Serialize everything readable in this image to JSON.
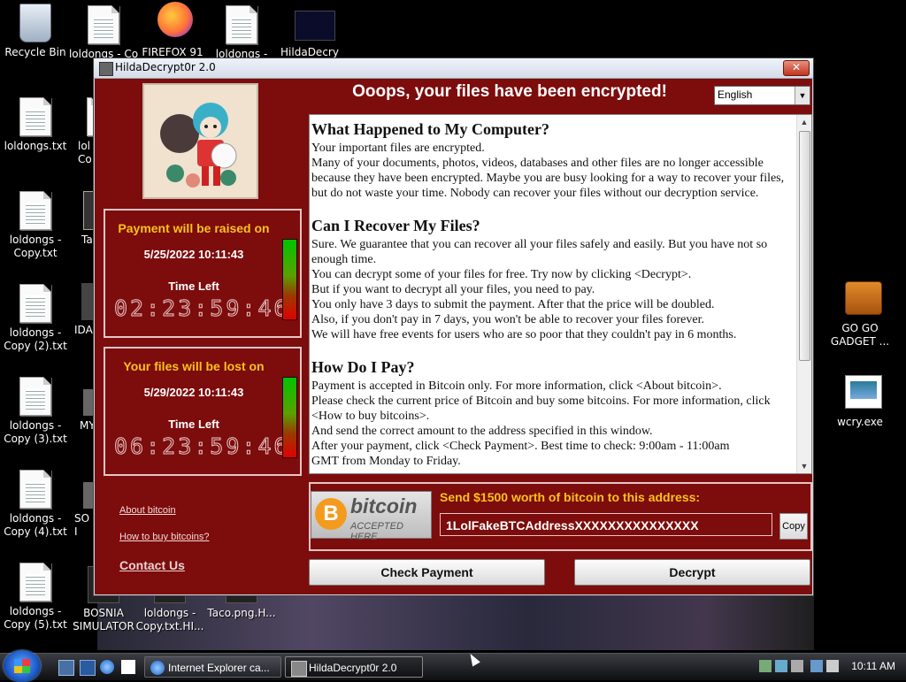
{
  "desktop": {
    "icons_left": [
      {
        "label": "Recycle Bin"
      },
      {
        "label": "loldongs.txt"
      },
      {
        "label": "loldongs - Copy.txt"
      },
      {
        "label": "loldongs - Copy (2).txt"
      },
      {
        "label": "loldongs - Copy (3).txt"
      },
      {
        "label": "loldongs - Copy (4).txt"
      },
      {
        "label": "loldongs - Copy (5).txt"
      }
    ],
    "icons_top": [
      {
        "label": "loldongs - Co"
      },
      {
        "label": "FIREFOX 91"
      },
      {
        "label": "loldongs -"
      },
      {
        "label": "HildaDecry"
      }
    ],
    "icons_partial": [
      {
        "label": "lol Co"
      },
      {
        "label": "Ta"
      },
      {
        "label": "IDA"
      },
      {
        "label": "MY"
      },
      {
        "label": "SO I"
      }
    ],
    "icons_bottom": [
      {
        "label": "BOSNIA SIMULATOR"
      },
      {
        "label": "loldongs - Copy.txt.HI..."
      },
      {
        "label": "Taco.png.H..."
      }
    ],
    "icons_right": [
      {
        "label": "GO GO GADGET ..."
      },
      {
        "label": "wcry.exe"
      }
    ]
  },
  "window": {
    "title": "HildaDecrypt0r 2.0",
    "close": "✕",
    "headline": "Ooops, your files have been encrypted!",
    "language": "English",
    "panel1": {
      "heading": "Payment will be raised on",
      "date": "5/25/2022 10:11:43",
      "label": "Time Left",
      "timer": "02:23:59:46",
      "bar_level": 0.75
    },
    "panel2": {
      "heading": "Your files will be lost on",
      "date": "5/29/2022 10:11:43",
      "label": "Time Left",
      "timer": "06:23:59:46",
      "bar_level": 0.95
    },
    "links": {
      "about": "About bitcoin",
      "howto": "How to buy bitcoins?",
      "contact": "Contact Us"
    },
    "text": {
      "h1": "What Happened to My Computer?",
      "p1": "Your important files are encrypted.",
      "p2": "Many of your documents, photos, videos, databases and other files are no longer accessible because they have been encrypted. Maybe you are busy looking for a way to recover your files, but do not waste your time. Nobody can recover your files without our decryption service.",
      "h2": "Can I Recover My Files?",
      "p3": "Sure. We guarantee that you can recover all your files safely and easily. But you have not so enough time.",
      "p4": "You can decrypt some of your files for free. Try now by clicking <Decrypt>.",
      "p5": "But if you want to decrypt all your files, you need to pay.",
      "p6": "You only have 3 days to submit the payment. After that the price will be doubled.",
      "p7": "Also, if you don't pay in 7 days, you won't be able to recover your files forever.",
      "p8": "We will have free events for users who are so poor that they couldn't pay in 6 months.",
      "h3": "How Do I Pay?",
      "p9": "Payment is accepted in Bitcoin only. For more information, click <About bitcoin>.",
      "p10": "Please check the current price of Bitcoin and buy some bitcoins. For more information, click <How to buy bitcoins>.",
      "p11": "And send the correct amount to the address specified in this window.",
      "p12": "After your payment, click <Check Payment>. Best time to check: 9:00am - 11:00am",
      "p13": "GMT from Monday to Friday."
    },
    "payment": {
      "logo_word": "bitcoin",
      "logo_sub": "ACCEPTED HERE",
      "logo_coin": "B",
      "send_label": "Send $1500 worth of bitcoin to this address:",
      "address": "1LolFakeBTCAddressXXXXXXXXXXXXXXX",
      "copy": "Copy"
    },
    "buttons": {
      "check": "Check Payment",
      "decrypt": "Decrypt"
    }
  },
  "taskbar": {
    "tasks": [
      {
        "label": "Internet Explorer ca..."
      },
      {
        "label": "HildaDecrypt0r 2.0"
      }
    ],
    "clock": "10:11 AM"
  }
}
